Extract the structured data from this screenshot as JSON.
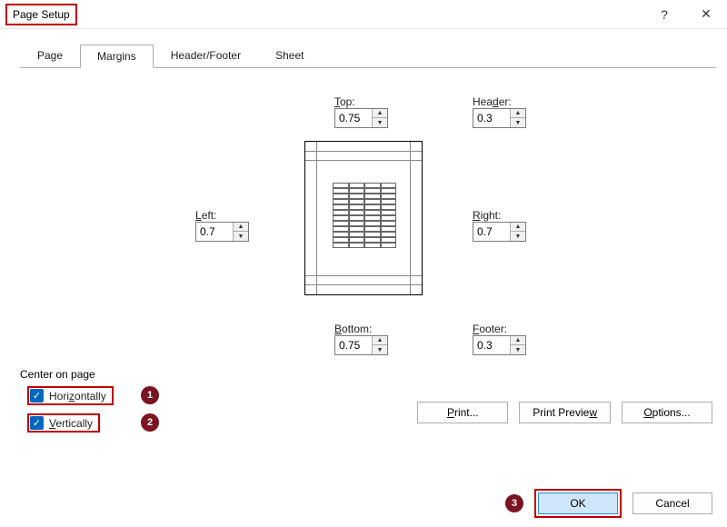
{
  "title": "Page Setup",
  "tabs": {
    "page": "Page",
    "margins": "Margins",
    "hf": "Header/Footer",
    "sheet": "Sheet"
  },
  "fields": {
    "top": {
      "label": "Top:",
      "accel": "T",
      "value": "0.75"
    },
    "header": {
      "label": "Header:",
      "accel": "H",
      "value": "0.3"
    },
    "left": {
      "label": "Left:",
      "accel": "L",
      "value": "0.7"
    },
    "right": {
      "label": "Right:",
      "accel": "R",
      "value": "0.7"
    },
    "bottom": {
      "label": "Bottom:",
      "accel": "B",
      "value": "0.75"
    },
    "footer": {
      "label": "Footer:",
      "accel": "F",
      "value": "0.3"
    }
  },
  "center": {
    "section": "Center on page",
    "horiz": "Horizontally",
    "vert": "Vertically"
  },
  "buttons": {
    "print": "Print...",
    "preview": "Print Preview",
    "options": "Options...",
    "ok": "OK",
    "cancel": "Cancel"
  },
  "annotations": {
    "b1": "1",
    "b2": "2",
    "b3": "3"
  }
}
